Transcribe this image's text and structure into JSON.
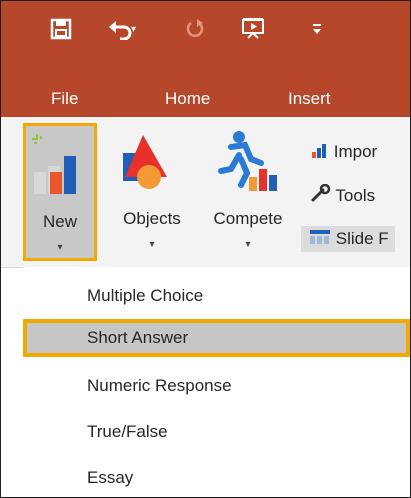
{
  "quick_access": {
    "icons": [
      "save-icon",
      "undo-icon",
      "redo-icon",
      "slideshow-icon",
      "customize-qat-icon"
    ]
  },
  "tabs": [
    {
      "label": "File"
    },
    {
      "label": "Home"
    },
    {
      "label": "Insert"
    }
  ],
  "ribbon": {
    "new": {
      "label": "New",
      "arrow": "▾"
    },
    "objects": {
      "label": "Objects",
      "arrow": "▾"
    },
    "compete": {
      "label": "Compete",
      "arrow": "▾"
    },
    "small_items": [
      {
        "label": "Impor",
        "icon": "import-chart-icon"
      },
      {
        "label": "Tools",
        "icon": "wrench-icon"
      },
      {
        "label": "Slide F",
        "icon": "slide-icon"
      }
    ]
  },
  "menu": {
    "items": [
      {
        "label": "Multiple Choice",
        "selected": false
      },
      {
        "label": "Short Answer",
        "selected": true
      },
      {
        "label": "Numeric Response",
        "selected": false
      },
      {
        "label": "True/False",
        "selected": false
      },
      {
        "label": "Essay",
        "selected": false
      }
    ]
  },
  "colors": {
    "titlebar": "#b7472a",
    "highlight": "#f2a900",
    "ribbon": "#f3f3f3",
    "selected_bg": "#c6c6c6"
  }
}
